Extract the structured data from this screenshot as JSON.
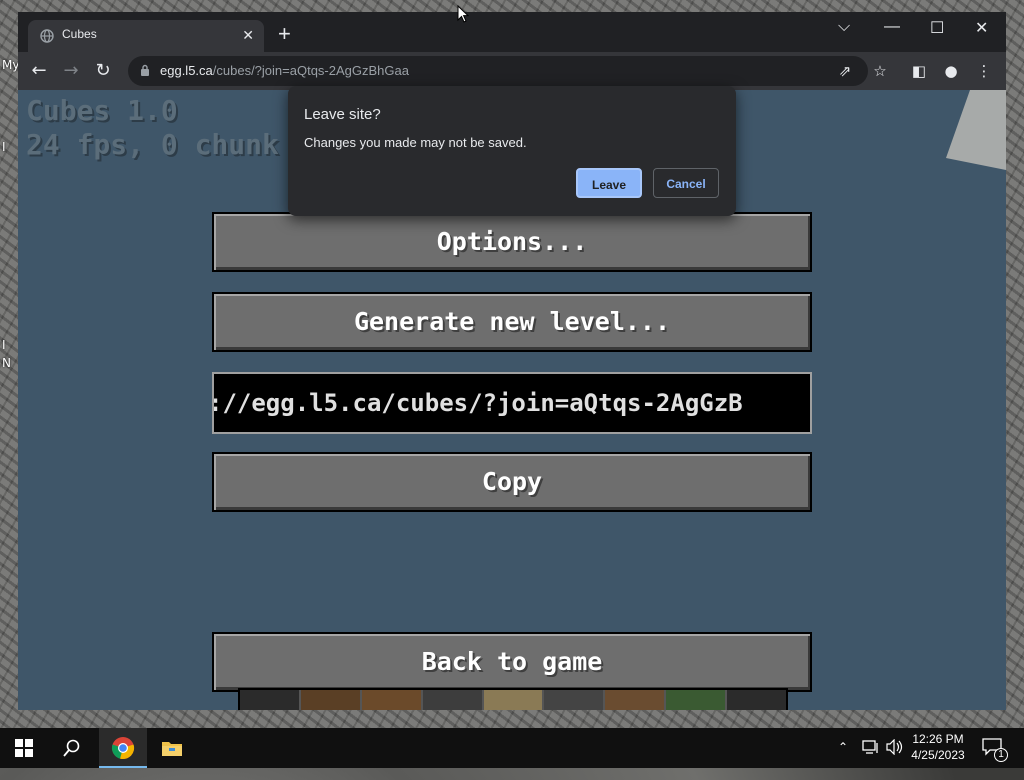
{
  "desktop": {
    "icon_labels": [
      "My",
      "I",
      "I",
      "N"
    ]
  },
  "browser": {
    "tab_title": "Cubes",
    "tab_close": "✕",
    "new_tab": "+",
    "window_controls": {
      "tab_search": "⌵",
      "minimize": "—",
      "maximize": "☐",
      "close": "✕"
    },
    "url_host": "egg.l5.ca",
    "url_path": "/cubes/?join=aQtqs-2AgGzBhGaa"
  },
  "game": {
    "hud_line1": "Cubes 1.0",
    "hud_line2": "24 fps, 0 chunk u",
    "buttons": {
      "options": "Options...",
      "generate": "Generate new level...",
      "copy": "Copy",
      "back": "Back to game"
    },
    "join_url_field": "://egg.l5.ca/cubes/?join=aQtqs-2AgGzB"
  },
  "dialog": {
    "title": "Leave site?",
    "message": "Changes you made may not be saved.",
    "leave_label": "Leave",
    "cancel_label": "Cancel"
  },
  "taskbar": {
    "time": "12:26 PM",
    "date": "4/25/2023",
    "notification_count": "1"
  },
  "colors": {
    "game_bg": "#3f5669",
    "button_gray": "#6e6e6e",
    "dialog_accent": "#8ab4f8"
  }
}
